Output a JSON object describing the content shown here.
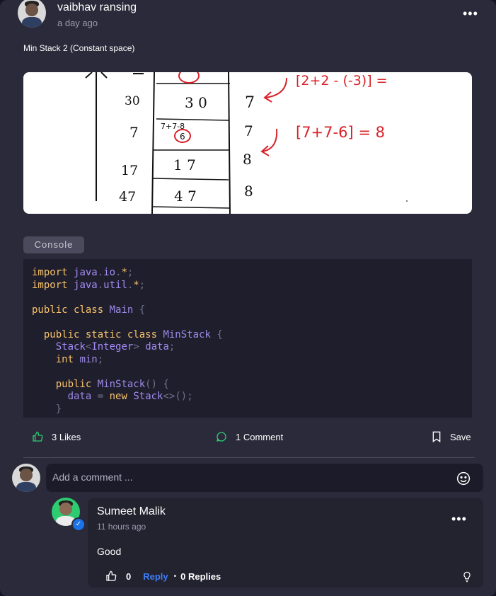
{
  "post": {
    "author": "vaibhav ransing",
    "time": "a day ago",
    "text": "Min Stack 2 (Constant  space)",
    "console_label": "Console",
    "image": {
      "rows": [
        {
          "left": "30",
          "mid": "3 0",
          "right": "7"
        },
        {
          "left": "7",
          "mid": "6",
          "right": "7",
          "annot": "7+7-8"
        },
        {
          "left": "17",
          "mid": "1 7",
          "right": "8"
        },
        {
          "left": "47",
          "mid": "4 7",
          "right": "8"
        }
      ],
      "formula_top": "[2+2 - (-3)] =",
      "formula_mid": "[7+7-6] = 8",
      "ink_color": "#d8232a"
    },
    "code_lines": [
      "import java.io.*;",
      "import java.util.*;",
      "",
      "public class Main {",
      "",
      "  public static class MinStack {",
      "    Stack<Integer> data;",
      "    int min;",
      "",
      "    public MinStack() {",
      "      data = new Stack<>();",
      "    }"
    ],
    "likes_label": "3 Likes",
    "comments_label": "1 Comment",
    "save_label": "Save"
  },
  "comment_input": {
    "placeholder": "Add a comment ..."
  },
  "comment": {
    "author": "Sumeet Malik",
    "time": "11 hours ago",
    "text": "Good",
    "likes": "0",
    "reply_label": "Reply",
    "separator": "•",
    "replies_label": "0 Replies"
  },
  "colors": {
    "accent_green": "#2ecc71",
    "reply_blue": "#3d7cf5",
    "background": "#2a2a3a"
  },
  "icons": [
    "thumbs-up-icon",
    "chat-bubble-icon",
    "bookmark-icon",
    "emoji-icon",
    "lightbulb-icon",
    "more-dots-icon",
    "verified-check-icon"
  ]
}
